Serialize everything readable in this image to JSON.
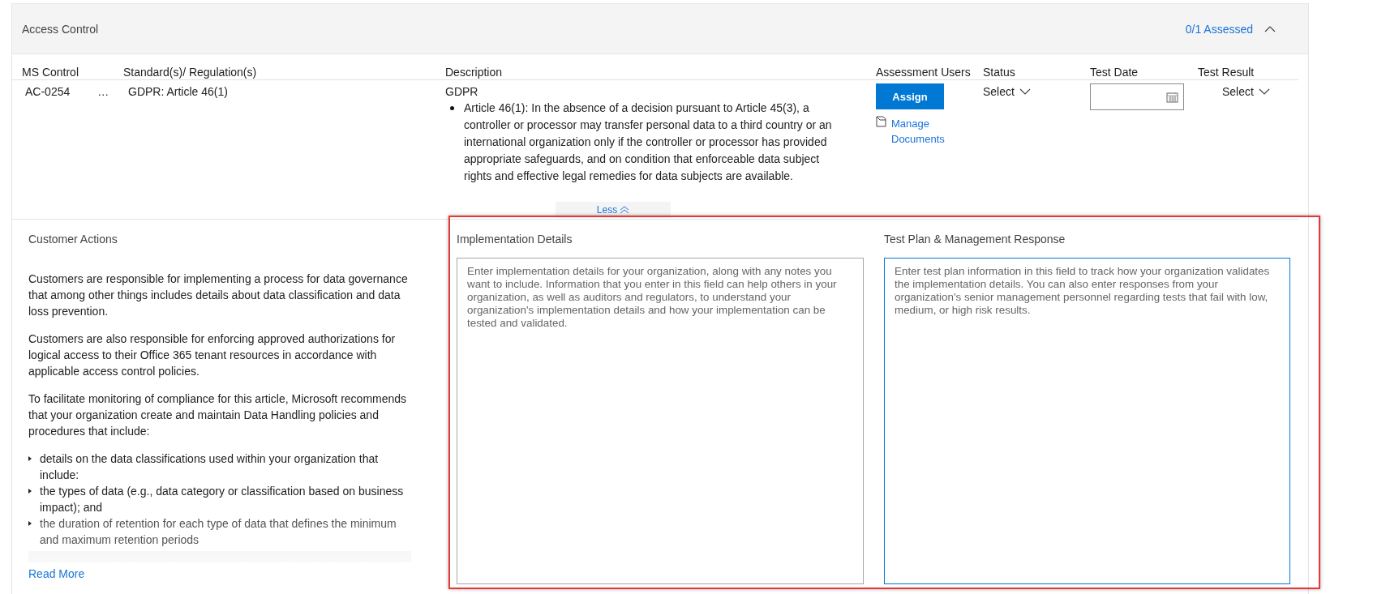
{
  "section": {
    "title": "Access Control",
    "assessed": "0/1 Assessed",
    "expanded": true
  },
  "columns": [
    "MS Control",
    "Standard(s)/ Regulation(s)",
    "Description",
    "Assessment Users",
    "Status",
    "Test Date",
    "Test Result"
  ],
  "row": {
    "ms_control": "AC-0254",
    "more": "…",
    "standard": "GDPR: Article 46(1)",
    "description_title": "GDPR",
    "description_items": [
      "Article 46(1): In the absence of a decision pursuant to Article 45(3), a controller or processor may transfer personal data to a third country or an international organization only if the controller or processor has provided appropriate safeguards, and on condition that enforceable data subject rights and effective legal remedies for data subjects are available."
    ],
    "assign_button": "Assign",
    "manage_documents": "Manage Documents",
    "status": "Select",
    "test_result": "Select"
  },
  "less_button": "Less",
  "customer_actions": {
    "title": "Customer Actions",
    "paragraphs": [
      "Customers are responsible for implementing a process for data governance that among other things includes details about data classification and data loss prevention.",
      "Customers are also responsible for enforcing approved authorizations for logical access to their Office 365 tenant resources in accordance with applicable access control policies.",
      "To facilitate monitoring of compliance for this article, Microsoft recommends that your organization create and maintain Data Handling policies and procedures that include:"
    ],
    "bullets": [
      "details on the data classifications used within your organization that include:",
      "the types of data (e.g., data category or classification based on business impact); and",
      "the duration of retention for each type of data that defines the minimum and maximum retention periods"
    ],
    "read_more": "Read More"
  },
  "fields": [
    {
      "label": "Implementation Details",
      "placeholder": "Enter implementation details for your organization, along with any notes you want to include. Information that you enter in this field can help others in your organization, as well as auditors and regulators, to understand your organization's implementation details and how your implementation can be tested and validated.",
      "focused": false
    },
    {
      "label": "Test Plan & Management Response",
      "placeholder": "Enter test plan information in this field to track how your organization validates the implementation details. You can also enter responses from your organization's senior management personnel regarding tests that fail with low, medium, or high risk results.",
      "focused": true
    }
  ],
  "highlight_frame": true
}
